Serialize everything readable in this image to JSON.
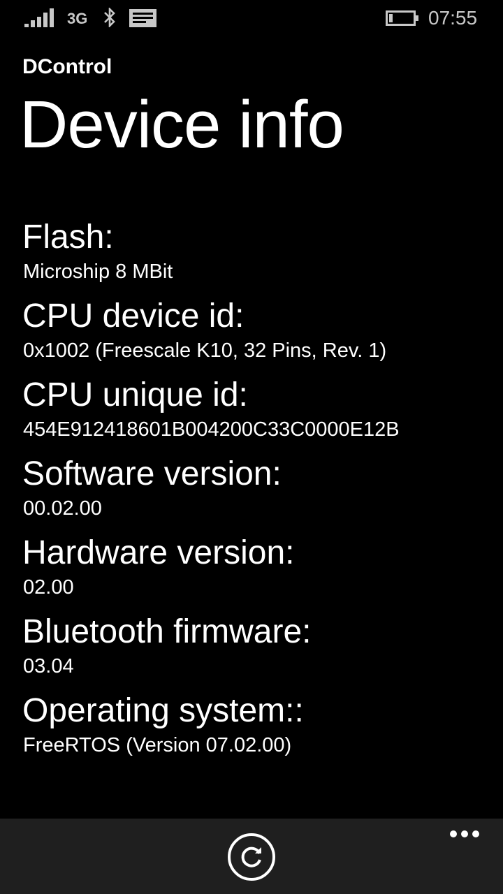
{
  "status_bar": {
    "network_type": "3G",
    "time": "07:55",
    "icons": [
      "signal-strength-icon",
      "bluetooth-icon",
      "message-icon",
      "battery-icon"
    ],
    "signal_bars": 5,
    "battery_level": 0.15
  },
  "header": {
    "app_name": "DControl",
    "page_title": "Device info"
  },
  "info": [
    {
      "label": "Flash:",
      "value": "Microship  8 MBit"
    },
    {
      "label": "CPU device id:",
      "value": "0x1002 (Freescale K10, 32 Pins, Rev. 1)"
    },
    {
      "label": "CPU unique id:",
      "value": "454E912418601B004200C33C0000E12B"
    },
    {
      "label": "Software version:",
      "value": "00.02.00"
    },
    {
      "label": "Hardware version:",
      "value": "02.00"
    },
    {
      "label": "Bluetooth firmware:",
      "value": "03.04"
    },
    {
      "label": "Operating system::",
      "value": "FreeRTOS (Version 07.02.00)"
    }
  ],
  "app_bar": {
    "buttons": [
      "refresh-icon",
      "more-icon"
    ]
  },
  "colors": {
    "background": "#000000",
    "text": "#ffffff",
    "status_text": "#c8c8c8",
    "app_bar": "#1f1f1f"
  }
}
